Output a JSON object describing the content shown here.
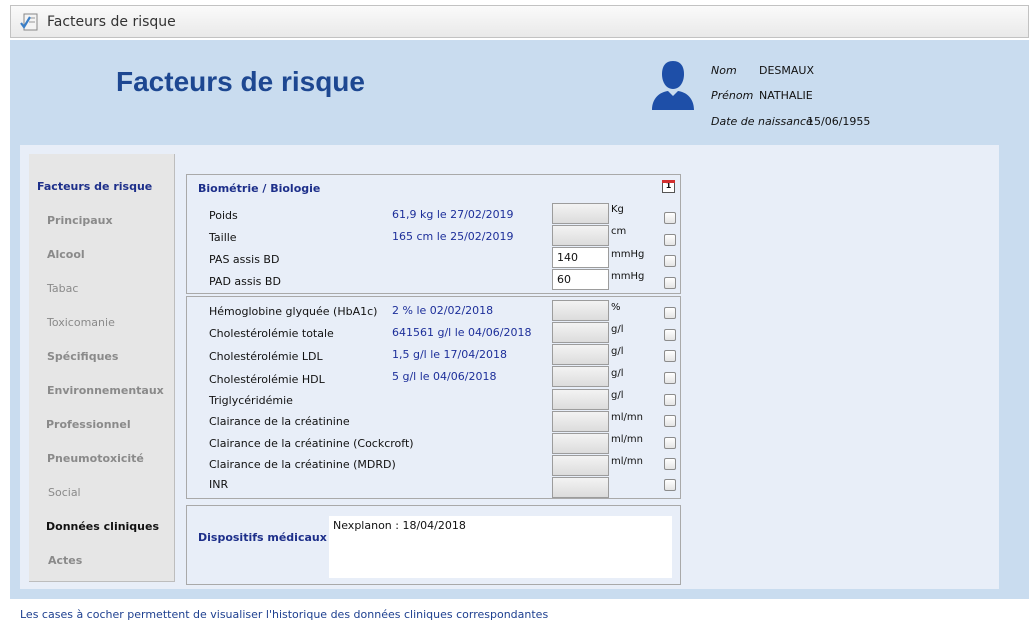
{
  "window": {
    "title": "Facteurs de risque",
    "icon": "checklist-icon"
  },
  "header": {
    "title": "Facteurs de risque"
  },
  "patient": {
    "nom_label": "Nom",
    "nom": "DESMAUX",
    "prenom_label": "Prénom",
    "prenom": "NATHALIE",
    "naissance_label": "Date de naissance",
    "naissance": "15/06/1955"
  },
  "sidebar": {
    "items": [
      {
        "label": "Facteurs de risque"
      },
      {
        "label": "Principaux"
      },
      {
        "label": "Alcool"
      },
      {
        "label": "Tabac"
      },
      {
        "label": "Toxicomanie"
      },
      {
        "label": "Spécifiques"
      },
      {
        "label": "Environnementaux"
      },
      {
        "label": "Professionnel"
      },
      {
        "label": "Pneumotoxicité"
      },
      {
        "label": "Social"
      },
      {
        "label": "Données cliniques"
      },
      {
        "label": "Actes"
      }
    ]
  },
  "biometrie": {
    "title": "Biométrie / Biologie",
    "calendar_icon_text": "1",
    "rows": [
      {
        "label": "Poids",
        "last": "61,9 kg le 27/02/2019",
        "value": "",
        "unit": "Kg"
      },
      {
        "label": "Taille",
        "last": "165 cm le 25/02/2019",
        "value": "",
        "unit": "cm"
      },
      {
        "label": "PAS assis BD",
        "last": "",
        "value": "140",
        "unit": "mmHg"
      },
      {
        "label": "PAD assis BD",
        "last": "",
        "value": "60",
        "unit": "mmHg"
      }
    ]
  },
  "biologie": {
    "rows": [
      {
        "label": "Hémoglobine glyquée (HbA1c)",
        "last": "2 % le 02/02/2018",
        "value": "",
        "unit": "%"
      },
      {
        "label": "Cholestérolémie totale",
        "last": "641561 g/l le 04/06/2018",
        "value": "",
        "unit": "g/l"
      },
      {
        "label": "Cholestérolémie LDL",
        "last": "1,5 g/l le 17/04/2018",
        "value": "",
        "unit": "g/l"
      },
      {
        "label": "Cholestérolémie HDL",
        "last": "5 g/l le 04/06/2018",
        "value": "",
        "unit": "g/l"
      },
      {
        "label": "Triglycéridémie",
        "last": "",
        "value": "",
        "unit": "g/l"
      },
      {
        "label": "Clairance de la créatinine",
        "last": "",
        "value": "",
        "unit": "ml/mn"
      },
      {
        "label": "Clairance de la créatinine (Cockcroft)",
        "last": "",
        "value": "",
        "unit": "ml/mn"
      },
      {
        "label": "Clairance de la créatinine (MDRD)",
        "last": "",
        "value": "",
        "unit": "ml/mn"
      },
      {
        "label": "INR",
        "last": "",
        "value": "",
        "unit": ""
      }
    ]
  },
  "dispositifs": {
    "title": "Dispositifs médicaux",
    "text": "Nexplanon : 18/04/2018"
  },
  "footer": {
    "note": "Les cases à cocher permettent de visualiser l'historique des données cliniques correspondantes"
  }
}
